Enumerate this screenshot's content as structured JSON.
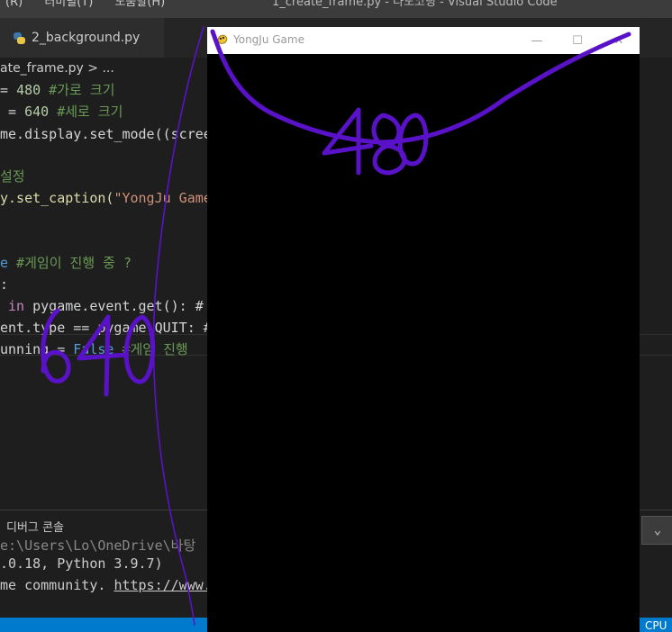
{
  "vscode": {
    "menu": [
      "(R)",
      "터미널(T)",
      "도움말(H)"
    ],
    "window_title": "1_create_frame.py - 나도코딩 - Visual Studio Code",
    "tab": {
      "label": "2_background.py",
      "icon": "python-icon"
    },
    "breadcrumb": "ate_frame.py > ...",
    "code": {
      "l1": {
        "a": "= ",
        "b": "480",
        "c": " #가로 크기"
      },
      "l2": {
        "a": " = ",
        "b": "640",
        "c": " #세로 크기"
      },
      "l3": {
        "a": "me.display.set_mode((scree"
      },
      "l4": {
        "a": "설정"
      },
      "l5": {
        "a": "y.set_caption(",
        "b": "\"YongJu Game"
      },
      "l6": {
        "a": "e",
        "b": " #게임이 진행 중 ?"
      },
      "l7": {
        "a": ":"
      },
      "l8": {
        "a": " ",
        "b": "in",
        "c": " pygame.event.get(): #"
      },
      "l9": {
        "a": "ent.type == pygame.QUIT: #"
      },
      "l10": {
        "a": "unning = ",
        "b": "False",
        "c": " #게임 진행"
      }
    },
    "panel": {
      "tab": "디버그 콘솔",
      "dropdown_icon": "chevron-down-icon",
      "lines": {
        "t1": "e:\\Users\\Lo\\OneDrive\\바탕",
        "t2": ".0.18, Python 3.9.7)",
        "t3a": "me community. ",
        "t3b": "https://www."
      }
    },
    "status": {
      "cpu": "CPU"
    }
  },
  "game_window": {
    "title": "YongJu Game",
    "icon": "pygame-snake-icon",
    "buttons": {
      "minimize": "—",
      "maximize": "☐",
      "close": "✕"
    }
  },
  "annotations": {
    "width_label": "480",
    "height_label": "640",
    "ink_color": "#5a12c8"
  },
  "colors": {
    "editor_bg": "#1e1e1e",
    "statusbar": "#007acc",
    "game_bg": "#000000"
  }
}
